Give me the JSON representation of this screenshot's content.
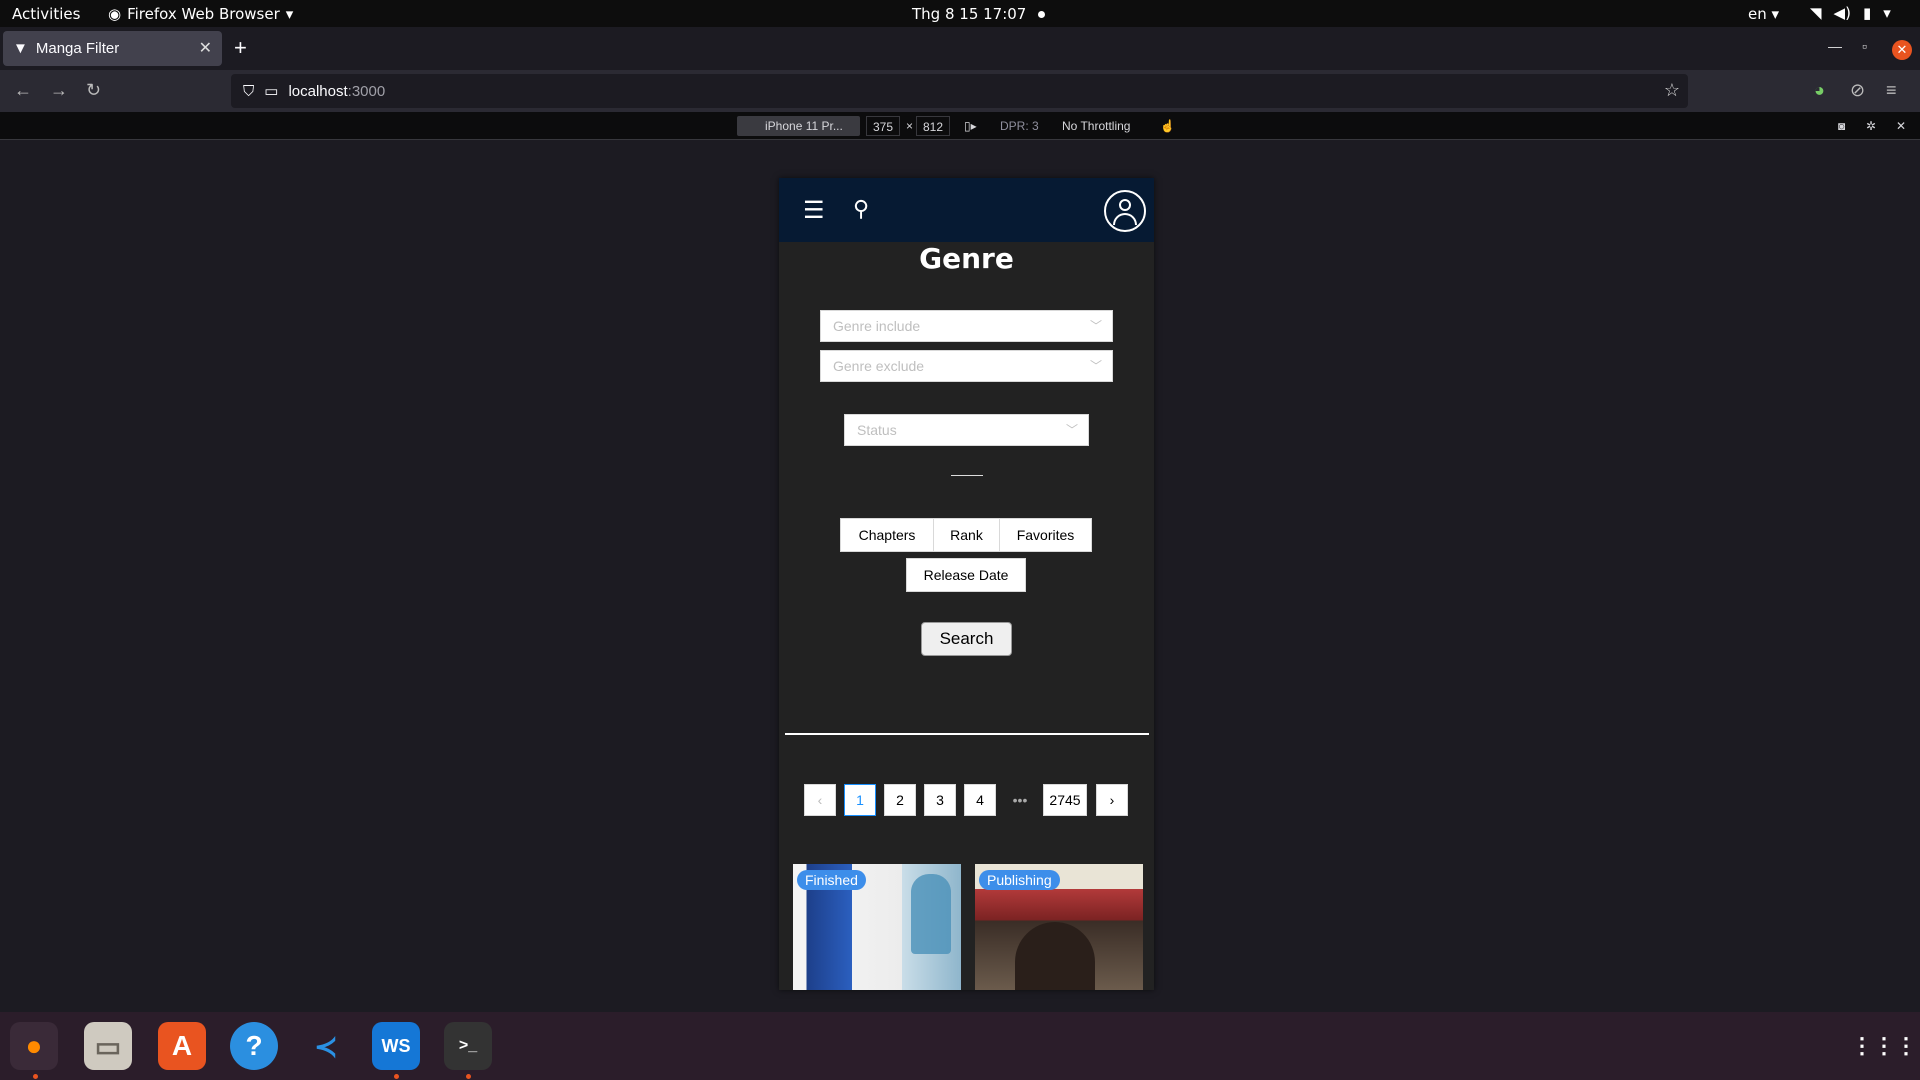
{
  "topbar": {
    "activities": "Activities",
    "app_name": "Firefox Web Browser",
    "clock": "Thg 8 15  17:07",
    "lang": "en"
  },
  "browser": {
    "tab_title": "Manga Filter",
    "url_host": "localhost",
    "url_port": ":3000"
  },
  "rdm": {
    "device": "iPhone 11 Pr...",
    "width": "375",
    "times": "×",
    "height": "812",
    "dpr": "DPR: 3",
    "throttling": "No Throttling"
  },
  "page": {
    "genre_title": "Genre",
    "genre_include_placeholder": "Genre include",
    "genre_exclude_placeholder": "Genre exclude",
    "status_placeholder": "Status",
    "sort": {
      "chapters": "Chapters",
      "rank": "Rank",
      "favorites": "Favorites",
      "release_date": "Release Date"
    },
    "search_label": "Search",
    "pagination": {
      "prev": "‹",
      "pages": [
        "1",
        "2",
        "3",
        "4"
      ],
      "ellipsis": "•••",
      "last": "2745",
      "next": "›",
      "current": 1
    },
    "cards": [
      {
        "status": "Finished"
      },
      {
        "status": "Publishing"
      }
    ]
  },
  "icons": {
    "menu": "hamburger-icon",
    "search": "search-icon",
    "avatar": "user-icon"
  },
  "colors": {
    "appbar": "#061a33",
    "page_bg": "#222222",
    "badge": "#3d8eea",
    "active_page": "#1890ff"
  }
}
